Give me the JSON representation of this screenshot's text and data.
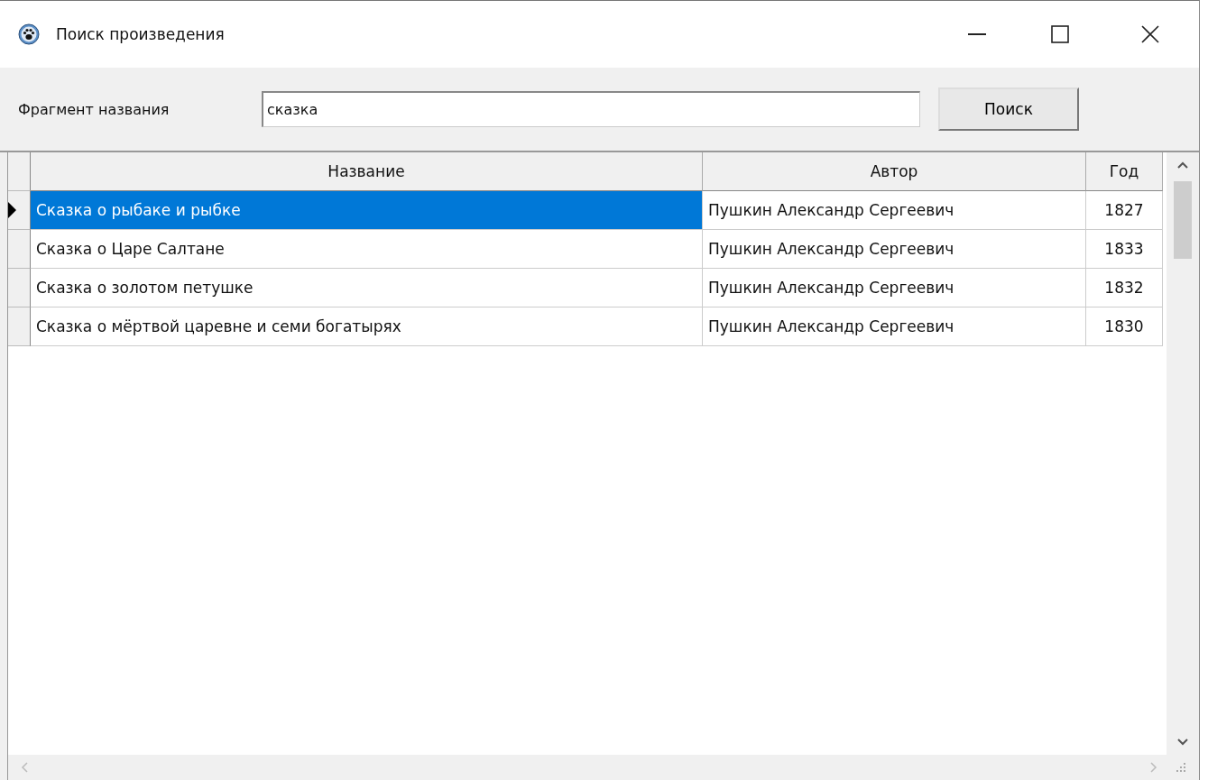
{
  "window": {
    "title": "Поиск произведения"
  },
  "search": {
    "label": "Фрагмент названия",
    "value": "сказка",
    "button": "Поиск"
  },
  "table": {
    "columns": [
      "Название",
      "Автор",
      "Год"
    ],
    "rows": [
      {
        "cells": [
          "Сказка о рыбаке и рыбке",
          "Пушкин Александр Сергеевич",
          "1827"
        ],
        "selected": true
      },
      {
        "cells": [
          "Сказка о Царе Салтане",
          "Пушкин Александр Сергеевич",
          "1833"
        ],
        "selected": false
      },
      {
        "cells": [
          "Сказка о золотом петушке",
          "Пушкин Александр Сергеевич",
          "1832"
        ],
        "selected": false
      },
      {
        "cells": [
          "Сказка о мёртвой царевне и семи богатырях",
          "Пушкин Александр Сергеевич",
          "1830"
        ],
        "selected": false
      }
    ]
  }
}
